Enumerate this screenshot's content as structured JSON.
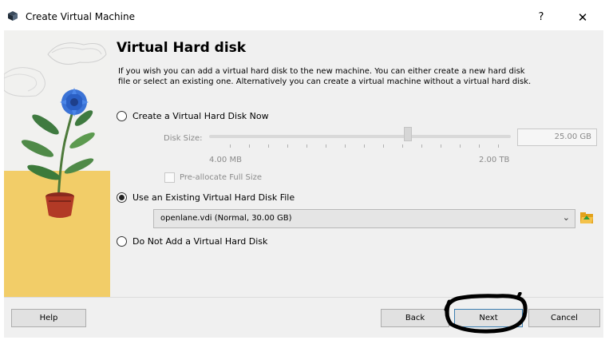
{
  "window": {
    "title": "Create Virtual Machine",
    "help_label": "?",
    "close_label": "✕"
  },
  "page": {
    "heading": "Virtual Hard disk",
    "description": "If you wish you can add a virtual hard disk to the new machine. You can either create a new hard disk file or select an existing one. Alternatively you can create a virtual machine without a virtual hard disk."
  },
  "options": {
    "create_now": {
      "label": "Create a Virtual Hard Disk Now",
      "selected": false
    },
    "use_existing": {
      "label": "Use an Existing Virtual Hard Disk File",
      "selected": true
    },
    "no_disk": {
      "label": "Do Not Add a Virtual Hard Disk",
      "selected": false
    }
  },
  "disk_size": {
    "label": "Disk Size:",
    "value": "25.00 GB",
    "min_label": "4.00 MB",
    "max_label": "2.00 TB",
    "enabled": false
  },
  "preallocate": {
    "label": "Pre-allocate Full Size",
    "checked": false,
    "enabled": false
  },
  "existing_disk": {
    "selected": "openlane.vdi (Normal, 30.00 GB)"
  },
  "buttons": {
    "help": "Help",
    "back": "Back",
    "next": "Next",
    "cancel": "Cancel"
  },
  "colors": {
    "content_bg": "#f0f0f0",
    "default_button_border": "#3c7fb1",
    "disabled_text": "#8a8a8a"
  },
  "icons": {
    "app": "virtualbox-cube-icon",
    "folder": "folder-open-icon",
    "dropdown": "chevron-down-icon"
  }
}
